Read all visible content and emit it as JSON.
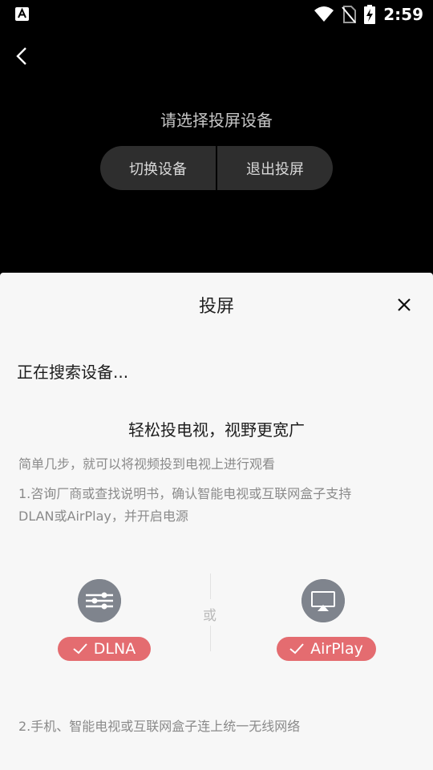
{
  "status_bar": {
    "time": "2:59",
    "icons": [
      "a-notification-icon",
      "wifi-icon",
      "no-sim-icon",
      "battery-charging-icon"
    ]
  },
  "top": {
    "prompt": "请选择投屏设备",
    "switch_device_label": "切换设备",
    "exit_cast_label": "退出投屏"
  },
  "sheet": {
    "title": "投屏",
    "searching": "正在搜索设备...",
    "headline": "轻松投电视，视野更宽广",
    "subline": "简单几步，就可以将视频投到电视上进行观看",
    "step1_line1": "1.咨询厂商或查找说明书，确认智能电视或互联网盒子支持",
    "step1_line2": "DLAN或AirPlay，并开启电源",
    "dlna_label": "DLNA",
    "or_label": "或",
    "airplay_label": "AirPlay",
    "step2": "2.手机、智能电视或互联网盒子连上统一无线网络"
  },
  "colors": {
    "badge": "#e46c70",
    "icon_circle": "#7f848d",
    "sheet_bg": "#f7f7f7"
  }
}
